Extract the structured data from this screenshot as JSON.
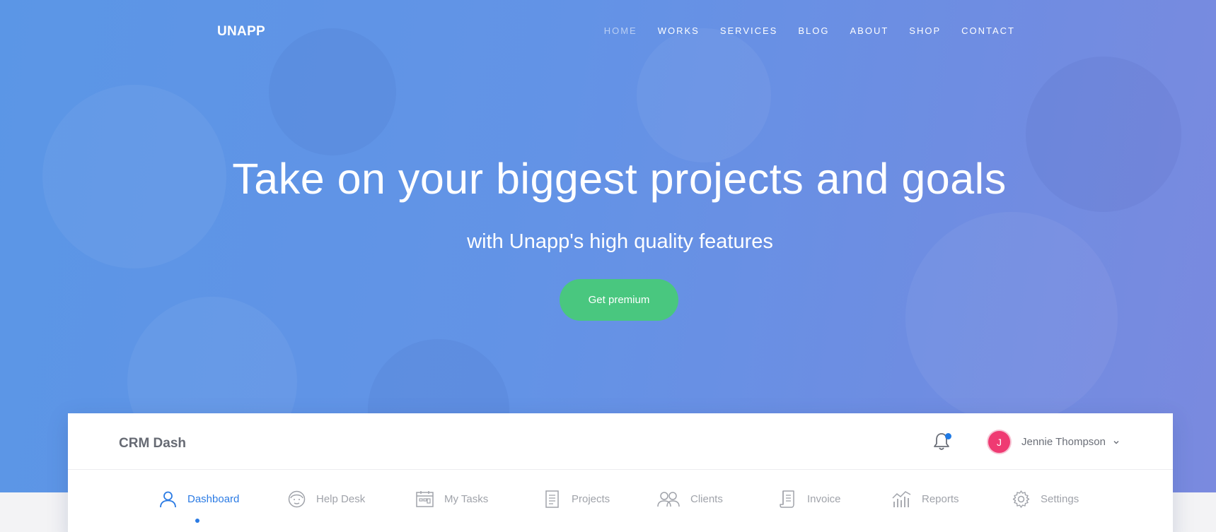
{
  "brand": {
    "logo": "UNAPP"
  },
  "nav": {
    "items": [
      "HOME",
      "WORKS",
      "SERVICES",
      "BLOG",
      "ABOUT",
      "SHOP",
      "CONTACT"
    ],
    "active": "HOME"
  },
  "hero": {
    "title": "Take on your biggest projects and goals",
    "subtitle": "with Unapp's high quality features",
    "cta_label": "Get premium"
  },
  "dashboard": {
    "app_name": "CRM Dash",
    "notifications_icon": "bell-icon",
    "has_unread": true,
    "user": {
      "initial": "J",
      "name": "Jennie Thompson"
    },
    "tabs": [
      {
        "label": "Dashboard",
        "icon": "user-icon",
        "active": true
      },
      {
        "label": "Help Desk",
        "icon": "support-agent-icon",
        "active": false
      },
      {
        "label": "My Tasks",
        "icon": "calendar-icon",
        "active": false
      },
      {
        "label": "Projects",
        "icon": "document-icon",
        "active": false
      },
      {
        "label": "Clients",
        "icon": "users-icon",
        "active": false
      },
      {
        "label": "Invoice",
        "icon": "invoice-icon",
        "active": false
      },
      {
        "label": "Reports",
        "icon": "bar-chart-icon",
        "active": false
      },
      {
        "label": "Settings",
        "icon": "gear-icon",
        "active": false
      }
    ]
  },
  "colors": {
    "accent": "#2b7be4",
    "cta": "#49c77f",
    "avatar": "#ef3a72",
    "hero_start": "#5b96e6",
    "hero_end": "#7a8adf"
  }
}
